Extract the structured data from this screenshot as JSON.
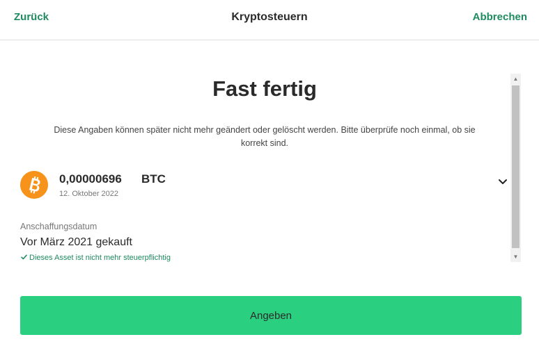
{
  "header": {
    "back_label": "Zurück",
    "title": "Kryptosteuern",
    "cancel_label": "Abbrechen"
  },
  "main": {
    "heading": "Fast fertig",
    "subtitle": "Diese Angaben können später nicht mehr geändert oder gelöscht werden. Bitte überprüfe noch ein­mal, ob sie korrekt sind."
  },
  "asset": {
    "icon": "bitcoin-icon",
    "amount": "0,00000696",
    "currency": "BTC",
    "date": "12. Oktober 2022",
    "expand_icon": "chevron-down-icon"
  },
  "acquisition": {
    "label": "Anschaffungsdatum",
    "value": "Vor März 2021 gekauft",
    "hint": "Dieses Asset ist nicht mehr steuerpflichtig"
  },
  "actions": {
    "submit_label": "Angeben"
  },
  "colors": {
    "accent_green": "#2ad07f",
    "link_green": "#1e8a5f",
    "bitcoin_orange": "#f7931a"
  }
}
